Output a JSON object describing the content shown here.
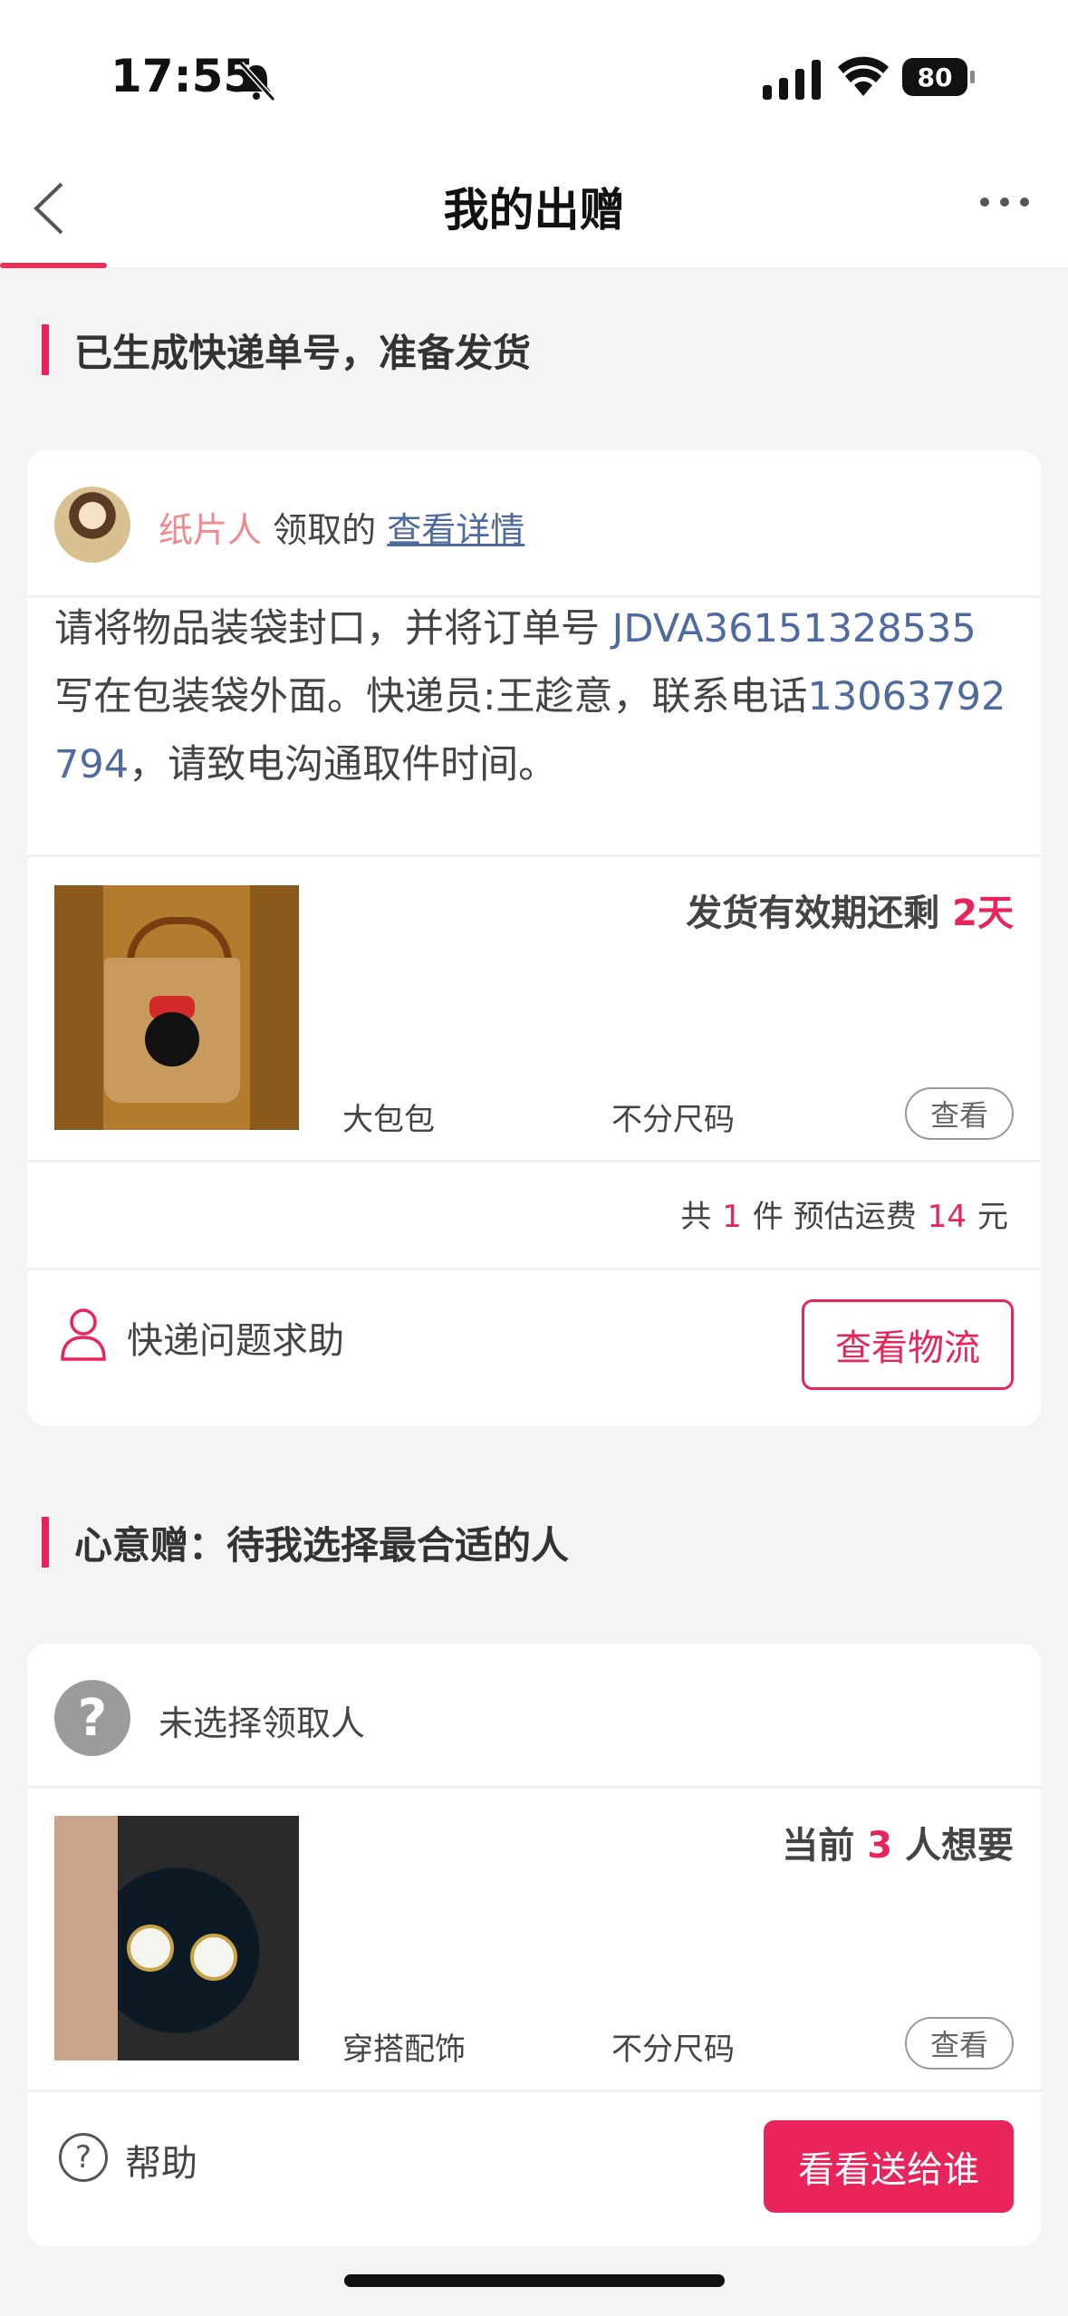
{
  "status_bar": {
    "time": "17:55",
    "battery": "80"
  },
  "nav": {
    "title": "我的出赠"
  },
  "section1": {
    "heading": "已生成快递单号，准备发货",
    "receiver_name": "纸片人",
    "receiver_suffix": "领取的",
    "details_link": "查看详情",
    "instruction_part1": "请将物品装袋封口，并将订单号 ",
    "order_number": "JDVA36151328535",
    "instruction_part2": " 写在包装袋外面。快递员:王趁意，联系电话",
    "phone": "13063792794",
    "instruction_part3": "，请致电沟通取件时间。",
    "validity_prefix": "发货有效期还剩 ",
    "validity_value": "2天",
    "item_name": "大包包",
    "item_size": "不分尺码",
    "view_label": "查看",
    "summary_prefix": "共",
    "summary_count": "1",
    "summary_mid": "件 预估运费",
    "summary_fee": "14",
    "summary_unit": "元",
    "help_label": "快递问题求助",
    "logistics_button": "查看物流"
  },
  "section2": {
    "heading": "心意赠：待我选择最合适的人",
    "no_receiver": "未选择领取人",
    "unknown_mark": "?",
    "wanted_prefix": "当前 ",
    "wanted_count": "3",
    "wanted_suffix": " 人想要",
    "item_name": "穿搭配饰",
    "item_size": "不分尺码",
    "view_label": "查看",
    "help_label": "帮助",
    "help_mark": "?",
    "send_button": "看看送给谁"
  },
  "colors": {
    "accent": "#e8245a",
    "link": "#4e6a9e",
    "name_pink": "#f2878e"
  }
}
